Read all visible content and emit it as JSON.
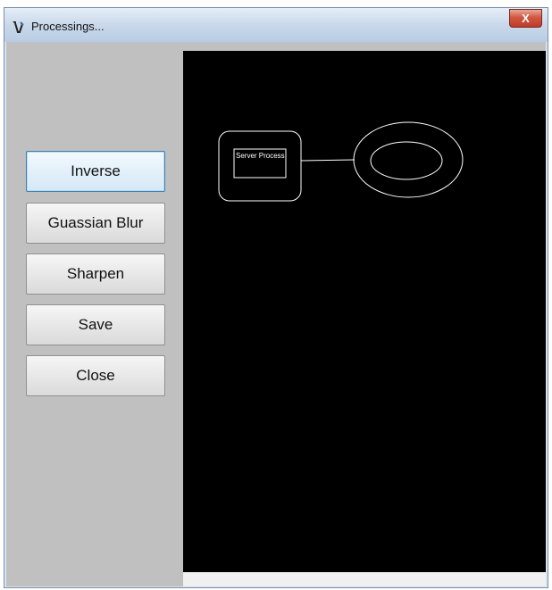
{
  "window": {
    "title": "Processings...",
    "close_label": "X"
  },
  "sidebar": {
    "buttons": [
      {
        "label": "Inverse"
      },
      {
        "label": "Guassian Blur"
      },
      {
        "label": "Sharpen"
      },
      {
        "label": "Save"
      },
      {
        "label": "Close"
      }
    ]
  },
  "canvas": {
    "server_label": "Server Process"
  },
  "colors": {
    "canvas_bg": "#000000",
    "sidebar_bg": "#c0c0c0",
    "stroke": "#ffffff"
  }
}
